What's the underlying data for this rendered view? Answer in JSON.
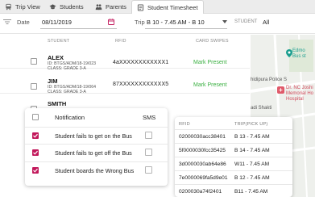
{
  "tabs": [
    {
      "label": "Trip View",
      "icon": "bus-icon"
    },
    {
      "label": "Students",
      "icon": "graduation-cap-icon"
    },
    {
      "label": "Parents",
      "icon": "parents-icon"
    },
    {
      "label": "Student Timesheet",
      "icon": "timesheet-icon",
      "active": true
    }
  ],
  "filters": {
    "date_label": "Date",
    "date_value": "08/11/2019",
    "trip_label": "Trip",
    "trip_value": "B 10 - 7.45 AM - B 10",
    "student_label": "STUDENT",
    "student_value": "All"
  },
  "table": {
    "headers": {
      "student": "STUDENT",
      "rfid": "RFID",
      "card_swipes": "CARD SWIPES"
    },
    "rows": [
      {
        "name": "ALEX",
        "id": "ID: BTGS/ADM/18-19/023",
        "class": "CLASS: GRADE 3-A",
        "rfid": "4aXXXXXXXXXXXX1",
        "swipe": "Mark Present"
      },
      {
        "name": "JIM",
        "id": "ID: BTGS/ADM/18-19/064",
        "class": "CLASS: GRADE 3-A",
        "rfid": "87XXXXXXXXXXXX5",
        "swipe": "Mark Present"
      },
      {
        "name": "SMITH",
        "id": "ID: BTGS/ADM/18-19/097",
        "class": "CLASS: GRADE 3-A",
        "rfid": "",
        "swipe": ""
      }
    ]
  },
  "map": {
    "labels": [
      "Edmo",
      "Bus st",
      "hidipura Police S",
      "Dr. NC Joshi",
      "Memorial Ho",
      "Hospital",
      "adi Shakti"
    ]
  },
  "notifications": {
    "header": "Notification",
    "sms_header": "SMS",
    "items": [
      {
        "label": "Student fails to get on the Bus",
        "checked": true,
        "sms": false
      },
      {
        "label": "Student fails to get off the Bus",
        "checked": true,
        "sms": false
      },
      {
        "label": "Student boards the Wrong Bus",
        "checked": true,
        "sms": false
      }
    ]
  },
  "rfid_panel": {
    "headers": {
      "rfid": "RFID",
      "trip": "TRIP(PICK UP)"
    },
    "rows": [
      {
        "rfid": "02000030acc38401",
        "trip": "B 13 - 7.45 AM"
      },
      {
        "rfid": "5f0000030fcc35425",
        "trip": "B 14 - 7.45 AM"
      },
      {
        "rfid": "3d0000030ab64e86",
        "trip": "W11 - 7.45 AM"
      },
      {
        "rfid": "7e0000069fa5d9e01",
        "trip": "B 12 - 7.45 AM"
      },
      {
        "rfid": "0200030a74f2401",
        "trip": "B11 - 7.45 AM"
      }
    ]
  },
  "colors": {
    "accent": "#c2185b",
    "present": "#3cb043"
  }
}
